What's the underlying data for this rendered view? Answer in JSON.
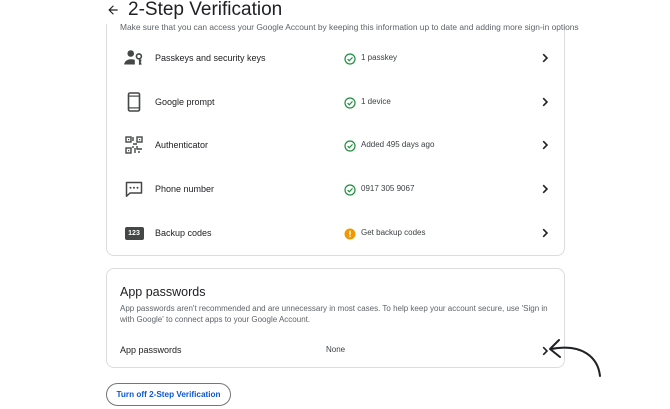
{
  "header": {
    "title": "2-Step Verification"
  },
  "subtitle": "Make sure that you can access your Google Account by keeping this information up to date and adding more sign-in options",
  "methods": [
    {
      "label": "Passkeys and security keys",
      "status": "1 passkey",
      "status_type": "ok",
      "icon": "passkey-person-key-icon"
    },
    {
      "label": "Google prompt",
      "status": "1 device",
      "status_type": "ok",
      "icon": "smartphone-icon"
    },
    {
      "label": "Authenticator",
      "status": "Added 495 days ago",
      "status_type": "ok",
      "icon": "qr-code-icon"
    },
    {
      "label": "Phone number",
      "status": "0917 305 9067",
      "status_type": "ok",
      "icon": "sms-message-icon"
    },
    {
      "label": "Backup codes",
      "status": "Get backup codes",
      "status_type": "warning",
      "icon": "backup-codes-123-icon",
      "icon_text": "123"
    }
  ],
  "app_passwords": {
    "title": "App passwords",
    "description": "App passwords aren't recommended and are unnecessary in most cases. To help keep your account secure, use 'Sign in with Google' to connect apps to your Google Account.",
    "row_label": "App passwords",
    "row_value": "None"
  },
  "actions": {
    "turn_off_label": "Turn off 2-Step Verification"
  },
  "colors": {
    "ok": "#1e8e3e",
    "warning": "#f29900",
    "link": "#0b57d0",
    "border": "#dadce0",
    "text": "#202124",
    "secondary_text": "#5f6368"
  }
}
